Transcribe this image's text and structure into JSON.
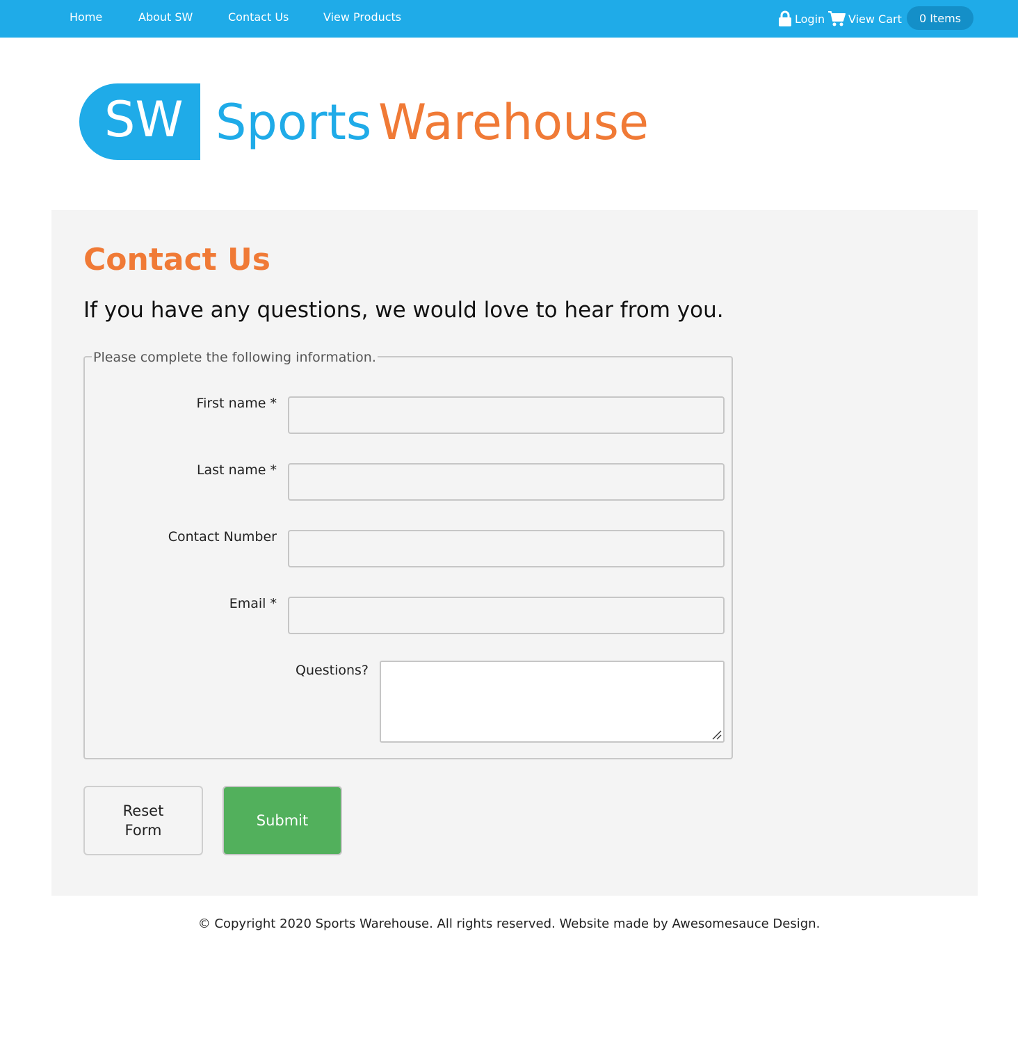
{
  "nav": {
    "home": "Home",
    "about": "About SW",
    "contact": "Contact Us",
    "products": "View Products"
  },
  "utility": {
    "login_icon": "lock-icon",
    "login": "Login",
    "cart_icon": "cart-icon",
    "cart": "View Cart",
    "items": "0 Items"
  },
  "logo": {
    "badge": "SW",
    "word1": "Sports",
    "word2": "Warehouse"
  },
  "colors": {
    "brand_blue": "#1fabe8",
    "brand_orange": "#f07a36",
    "submit_green": "#52b05c",
    "panel_bg": "#f4f4f4"
  },
  "page": {
    "title": "Contact Us",
    "intro": "If you have any questions, we would love to hear from you."
  },
  "form": {
    "legend": "Please complete the following information.",
    "fields": {
      "first_name": {
        "label": "First name *",
        "value": ""
      },
      "last_name": {
        "label": "Last name *",
        "value": ""
      },
      "contact_number": {
        "label": "Contact Number",
        "value": ""
      },
      "email": {
        "label": "Email *",
        "value": ""
      },
      "questions": {
        "label": "Questions?",
        "value": ""
      }
    },
    "reset_label": "Reset Form",
    "submit_label": "Submit"
  },
  "footer": {
    "text": "© Copyright 2020 Sports Warehouse. All rights reserved. Website made by Awesomesauce Design."
  }
}
